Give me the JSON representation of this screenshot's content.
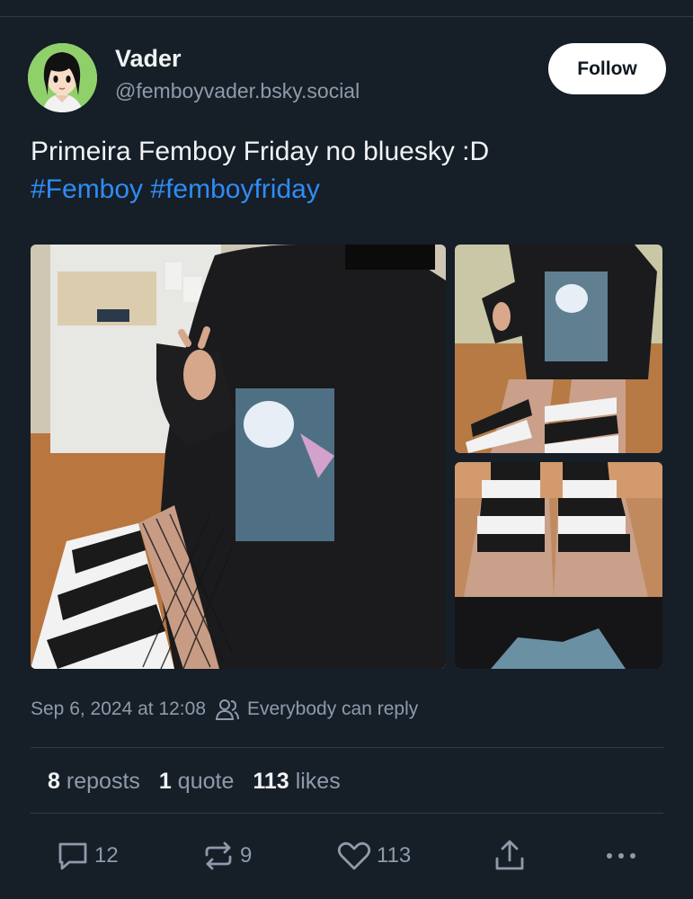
{
  "author": {
    "display_name": "Vader",
    "handle": "@femboyvader.bsky.social",
    "avatar_icon": "anime-avatar-icon"
  },
  "follow_label": "Follow",
  "post": {
    "text": "Primeira Femboy Friday no bluesky :D",
    "hashtags": [
      "#Femboy",
      "#femboyfriday"
    ]
  },
  "images": [
    {
      "name": "post-image-main"
    },
    {
      "name": "post-image-top-right"
    },
    {
      "name": "post-image-bottom-right"
    }
  ],
  "meta": {
    "timestamp": "Sep 6, 2024 at 12:08",
    "reply_setting": "Everybody can reply"
  },
  "stats": {
    "reposts_count": "8",
    "reposts_label": "reposts",
    "quotes_count": "1",
    "quotes_label": "quote",
    "likes_count": "113",
    "likes_label": "likes"
  },
  "actions": {
    "reply_count": "12",
    "repost_count": "9",
    "like_count": "113"
  },
  "colors": {
    "background": "#161e27",
    "hashtag": "#2f8cf5",
    "muted_text": "#8d9bab",
    "follow_button_bg": "#ffffff"
  }
}
